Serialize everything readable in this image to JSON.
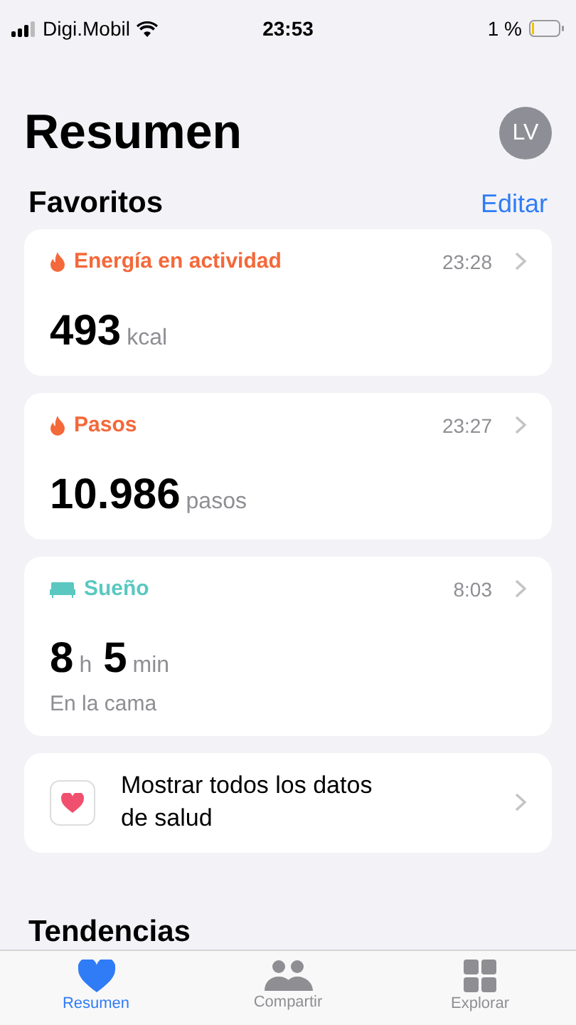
{
  "status_bar": {
    "carrier": "Digi.Mobil",
    "time": "23:53",
    "battery": "1 %"
  },
  "title": "Resumen",
  "avatar": "LV",
  "favorites": {
    "heading": "Favoritos",
    "action": "Editar"
  },
  "cards": [
    {
      "kind": "flame",
      "color": "#f4683a",
      "title": "Energía en actividad",
      "time": "23:28",
      "parts": [
        {
          "number": "493",
          "unit": "kcal"
        }
      ]
    },
    {
      "kind": "flame",
      "color": "#f4683a",
      "title": "Pasos",
      "time": "23:27",
      "parts": [
        {
          "number": "10.986",
          "unit": "pasos"
        }
      ]
    },
    {
      "kind": "bed",
      "color": "#5ac8c0",
      "title": "Sueño",
      "time": "8:03",
      "parts": [
        {
          "number": "8",
          "unit": "h"
        },
        {
          "number": "5",
          "unit": "min"
        }
      ],
      "caption": "En la cama"
    }
  ],
  "show_all": "Mostrar todos los datos de salud",
  "trends": "Tendencias",
  "tabs": [
    {
      "kind": "heart",
      "label": "Resumen",
      "selected": true
    },
    {
      "kind": "people",
      "label": "Compartir",
      "selected": false
    },
    {
      "kind": "grid",
      "label": "Explorar",
      "selected": false
    }
  ]
}
